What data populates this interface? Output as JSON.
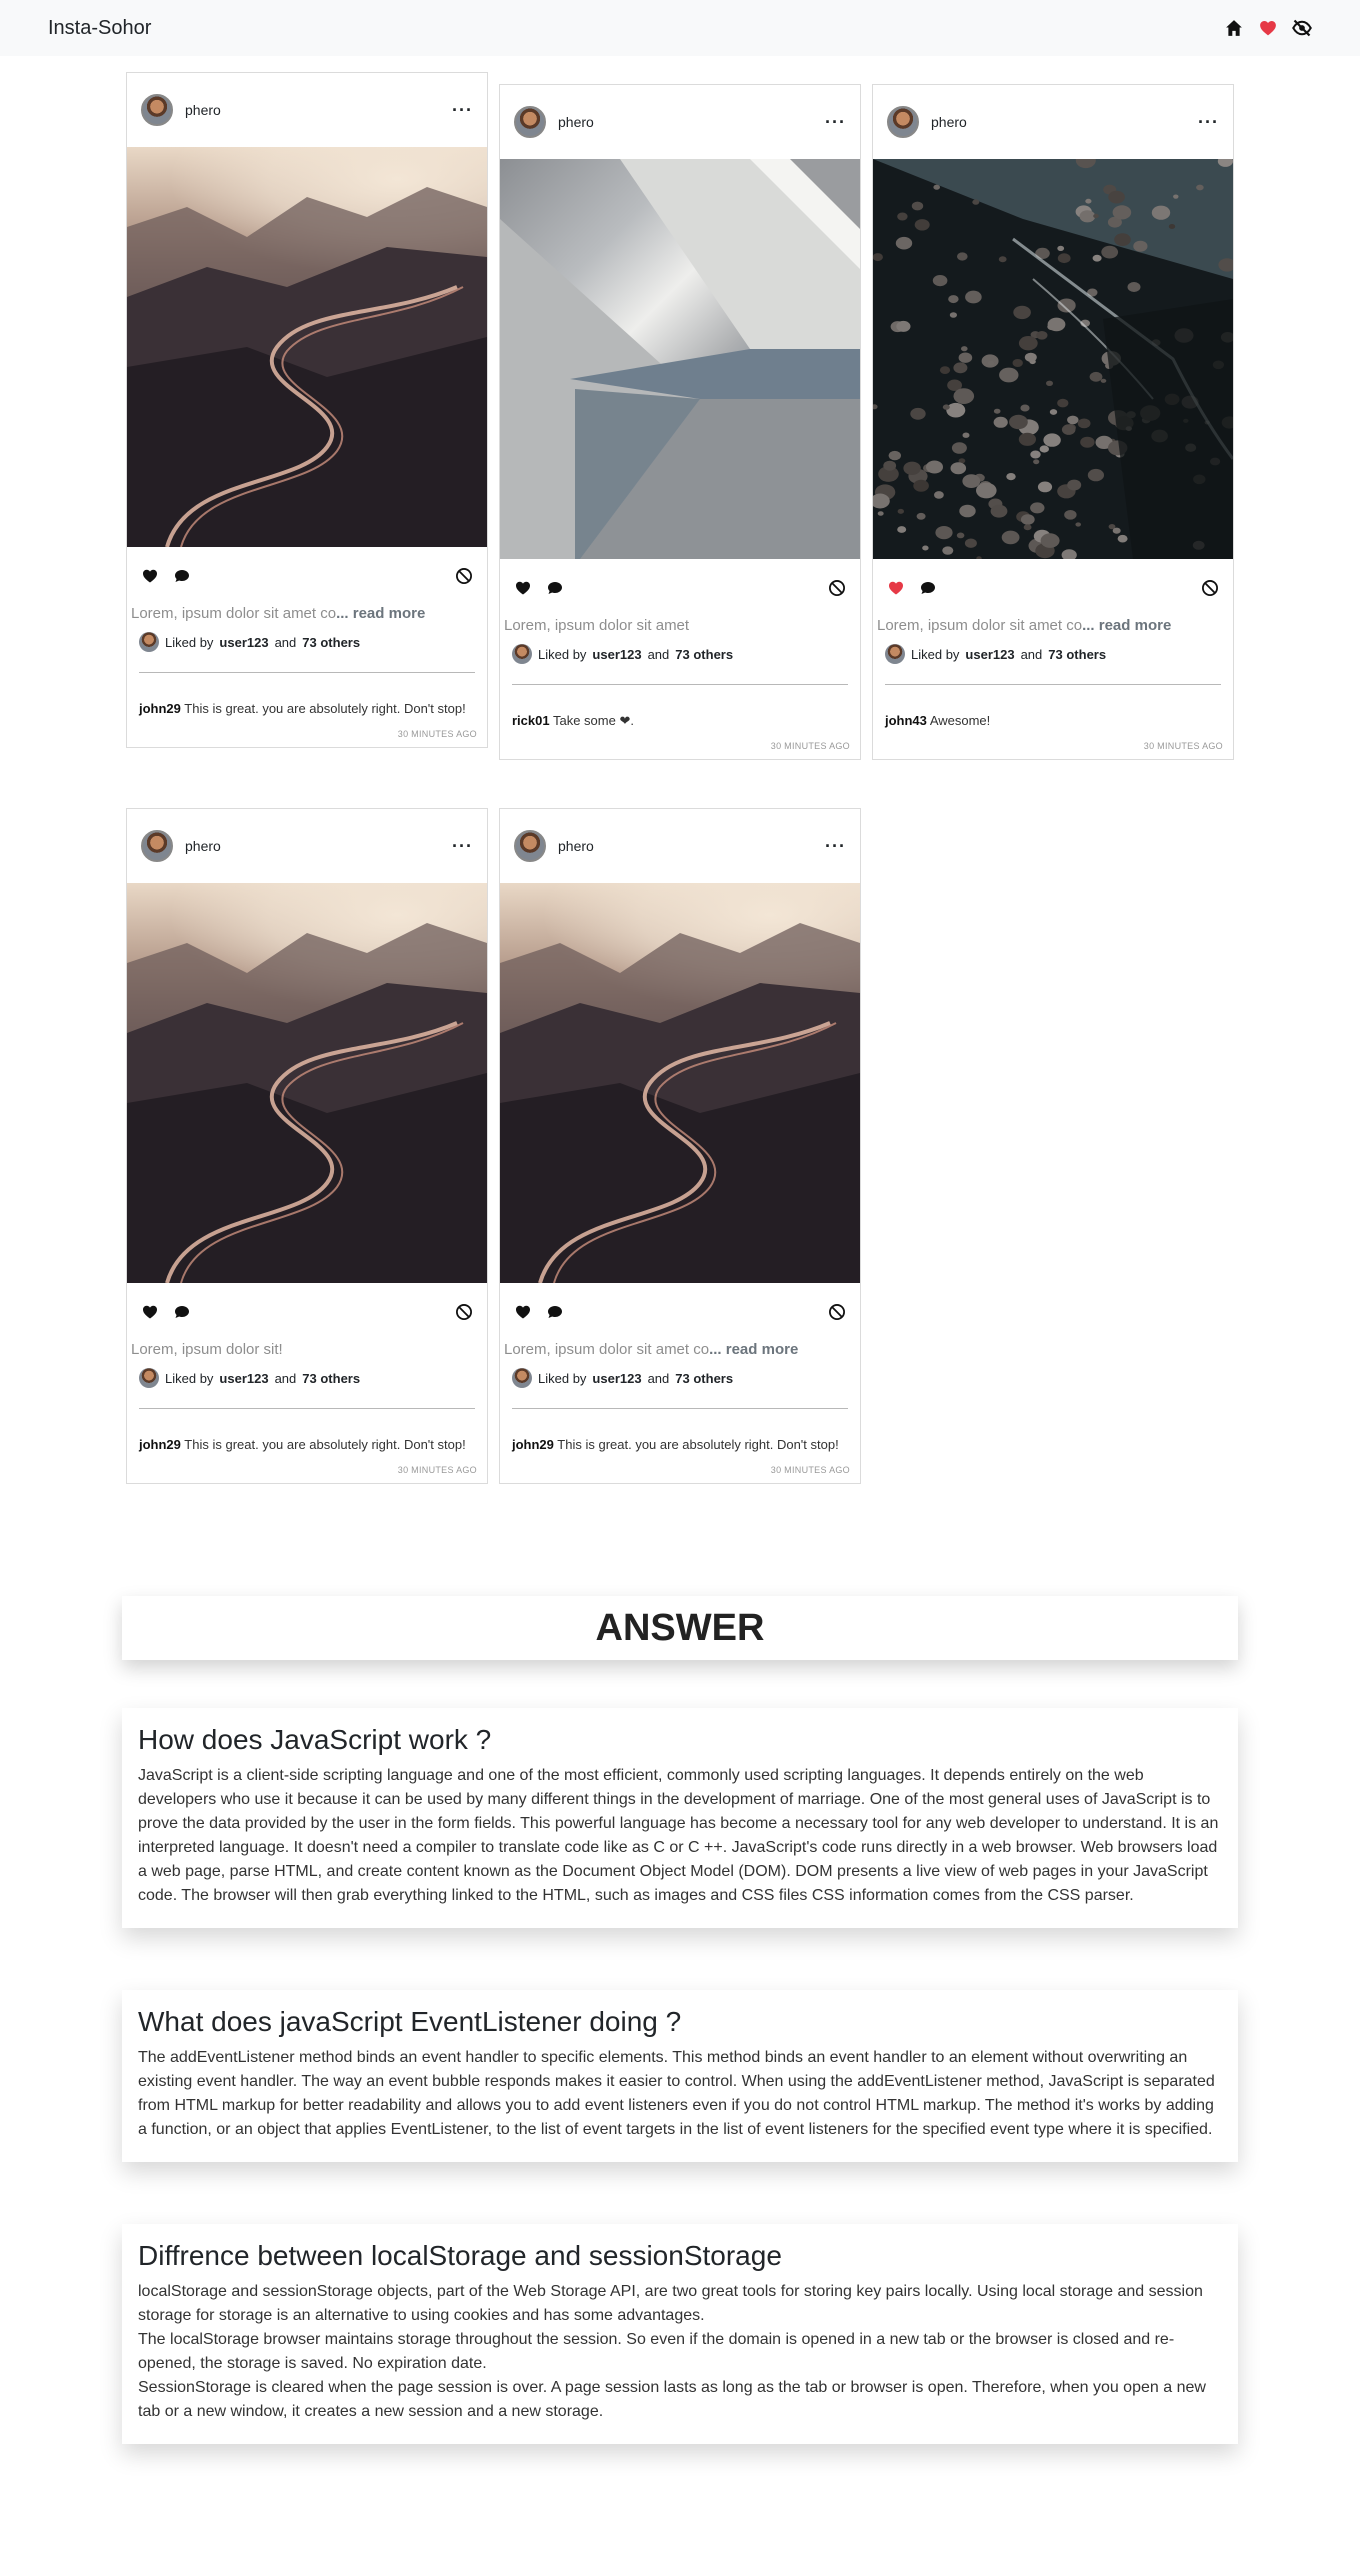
{
  "navbar": {
    "brand": "Insta-Sohor",
    "icons": [
      "home-icon",
      "heart-icon",
      "eye-slash-icon"
    ],
    "heart_color": "#e63946"
  },
  "posts": [
    {
      "username": "phero",
      "image": "mountain-road",
      "liked": false,
      "caption": "Lorem, ipsum dolor sit amet co",
      "read_more": "... read more",
      "liked_by_prefix": "Liked by",
      "liked_by_user": "user123",
      "liked_by_and": "and",
      "liked_by_others": "73 others",
      "comment_user": "john29",
      "comment_text": "This is great. you are absolutely right. Don't stop!",
      "time": "30 MINUTES AGO"
    },
    {
      "username": "phero",
      "image": "geometric",
      "liked": false,
      "caption": "Lorem, ipsum dolor sit amet",
      "read_more": "",
      "liked_by_prefix": "Liked by",
      "liked_by_user": "user123",
      "liked_by_and": "and",
      "liked_by_others": "73 others",
      "comment_user": "rick01",
      "comment_text": "Take some ❤.",
      "time": "30 MINUTES AGO"
    },
    {
      "username": "phero",
      "image": "pebbles-water",
      "liked": true,
      "caption": "Lorem, ipsum dolor sit amet co",
      "read_more": "... read more",
      "liked_by_prefix": "Liked by",
      "liked_by_user": "user123",
      "liked_by_and": "and",
      "liked_by_others": "73 others",
      "comment_user": "john43",
      "comment_text": "Awesome!",
      "time": "30 MINUTES AGO"
    },
    {
      "username": "phero",
      "image": "mountain-road",
      "liked": false,
      "caption": "Lorem, ipsum dolor sit!",
      "read_more": "",
      "liked_by_prefix": "Liked by",
      "liked_by_user": "user123",
      "liked_by_and": "and",
      "liked_by_others": "73 others",
      "comment_user": "john29",
      "comment_text": "This is great. you are absolutely right. Don't stop!",
      "time": "30 MINUTES AGO"
    },
    {
      "username": "phero",
      "image": "mountain-road",
      "liked": false,
      "caption": "Lorem, ipsum dolor sit amet co",
      "read_more": "... read more",
      "liked_by_prefix": "Liked by",
      "liked_by_user": "user123",
      "liked_by_and": "and",
      "liked_by_others": "73 others",
      "comment_user": "john29",
      "comment_text": "This is great. you are absolutely right. Don't stop!",
      "time": "30 MINUTES AGO"
    }
  ],
  "answer": {
    "title": "ANSWER",
    "cards": [
      {
        "heading": "How does JavaScript work ?",
        "paragraphs": [
          "JavaScript is a client-side scripting language and one of the most efficient, commonly used scripting languages. It depends entirely on the web developers who use it because it can be used by many different things in the development of marriage. One of the most general uses of JavaScript is to prove the data provided by the user in the form fields. This powerful language has become a necessary tool for any web developer to understand. It is an interpreted language. It doesn't need a compiler to translate code like as C or C ++. JavaScript's code runs directly in a web browser. Web browsers load a web page, parse HTML, and create content known as the Document Object Model (DOM). DOM presents a live view of web pages in your JavaScript code. The browser will then grab everything linked to the HTML, such as images and CSS files CSS information comes from the CSS parser."
        ]
      },
      {
        "heading": "What does javaScript EventListener doing ?",
        "paragraphs": [
          "The addEventListener method binds an event handler to specific elements. This method binds an event handler to an element without overwriting an existing event handler. The way an event bubble responds makes it easier to control. When using the addEventListener method, JavaScript is separated from HTML markup for better readability and allows you to add event listeners even if you do not control HTML markup. The method it's works by adding a function, or an object that applies EventListener, to the list of event targets in the list of event listeners for the specified event type where it is specified."
        ]
      },
      {
        "heading": "Diffrence between localStorage and sessionStorage",
        "paragraphs": [
          "localStorage and sessionStorage objects, part of the Web Storage API, are two great tools for storing key pairs locally. Using local storage and session storage for storage is an alternative to using cookies and has some advantages.",
          "The localStorage browser maintains storage throughout the session. So even if the domain is opened in a new tab or the browser is closed and re-opened, the storage is saved. No expiration date.",
          "SessionStorage is cleared when the page session is over. A page session lasts as long as the tab or browser is open. Therefore, when you open a new tab or a new window, it creates a new session and a new storage."
        ]
      }
    ]
  }
}
